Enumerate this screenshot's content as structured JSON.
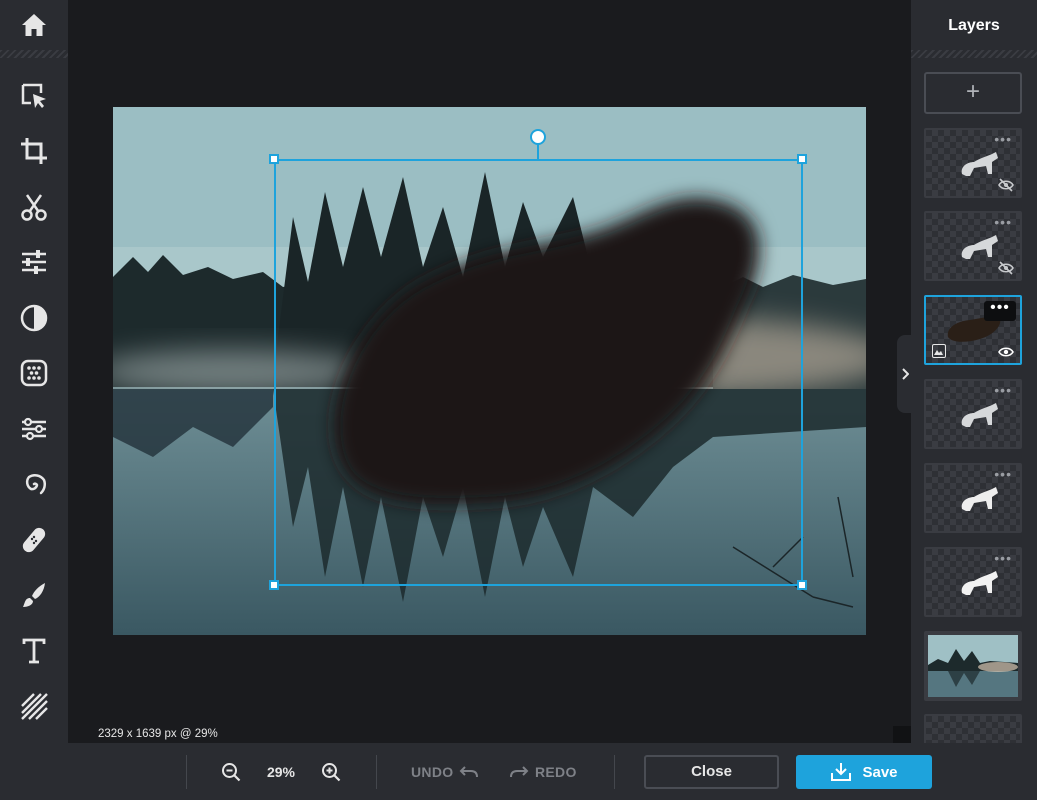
{
  "app": {
    "accent_color": "#1ea3dc",
    "toolbar_bg": "#2a2c31",
    "canvas_bg": "#1a1b1e"
  },
  "left_toolbar": {
    "home_icon": "home-icon",
    "tools": [
      {
        "name": "select-tool",
        "icon": "pointer-select-icon"
      },
      {
        "name": "crop-tool",
        "icon": "crop-icon"
      },
      {
        "name": "cutout-tool",
        "icon": "scissors-icon"
      },
      {
        "name": "adjust-tool",
        "icon": "sliders-icon"
      },
      {
        "name": "effects-tool",
        "icon": "half-circle-icon"
      },
      {
        "name": "texture-tool",
        "icon": "dots-square-icon"
      },
      {
        "name": "liquify-tool",
        "icon": "wave-nodes-icon"
      },
      {
        "name": "distort-tool",
        "icon": "spiral-icon"
      },
      {
        "name": "heal-tool",
        "icon": "bandage-icon"
      },
      {
        "name": "brush-tool",
        "icon": "brush-icon"
      },
      {
        "name": "text-tool",
        "icon": "text-icon"
      },
      {
        "name": "pattern-tool",
        "icon": "diagonal-stripes-icon"
      }
    ]
  },
  "canvas": {
    "size_readout": "2329 x 1639 px @ 29%"
  },
  "layers_panel": {
    "title": "Layers",
    "add_label": "+",
    "menu_dots": "•••",
    "layers": [
      {
        "type": "shape",
        "visible": false,
        "active": false
      },
      {
        "type": "shape",
        "visible": false,
        "active": false
      },
      {
        "type": "image",
        "visible": true,
        "active": true
      },
      {
        "type": "shape",
        "visible": true,
        "active": false
      },
      {
        "type": "shape",
        "visible": true,
        "active": false
      },
      {
        "type": "shape",
        "visible": true,
        "active": false
      },
      {
        "type": "photo",
        "visible": true,
        "active": false
      },
      {
        "type": "empty",
        "visible": true,
        "active": false
      }
    ]
  },
  "bottom_bar": {
    "zoom_value": "29%",
    "undo_label": "UNDO",
    "redo_label": "REDO",
    "close_label": "Close",
    "save_label": "Save"
  }
}
